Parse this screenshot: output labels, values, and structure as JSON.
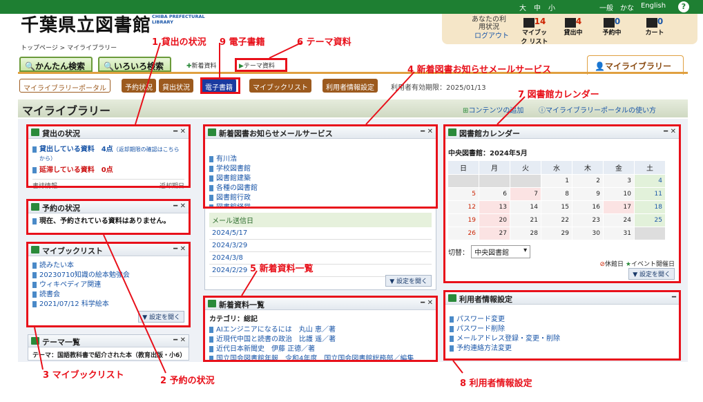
{
  "header": {
    "logo_text": "千葉県立図書館",
    "logo_sub": "CHIBA PREFECTURAL LIBRARY",
    "font_size_links": [
      "大",
      "中",
      "小"
    ],
    "lang_links": [
      "一般",
      "かな",
      "English"
    ],
    "help": "?",
    "status_label": "あなたの利用状況",
    "logout": "ログアウト",
    "stats": [
      {
        "label": "マイブック リスト",
        "count": "14",
        "icon": "bookshelf-icon"
      },
      {
        "label": "貸出中",
        "count": "4",
        "icon": "house-icon"
      },
      {
        "label": "予約中",
        "count": "0",
        "icon": "reserve-icon"
      },
      {
        "label": "カート",
        "count": "0",
        "icon": "cart-icon"
      }
    ]
  },
  "breadcrumb": "トップページ > マイライブラリー",
  "tabs": {
    "simple": "かんたん検索",
    "advanced": "いろいろ検索",
    "new": "新着資料",
    "theme": "テーマ資料",
    "mylibrary": "マイライブラリー"
  },
  "subnav": [
    "マイライブラリーポータル",
    "予約状況",
    "貸出状況",
    "電子書籍",
    "マイブックリスト",
    "利用者情報設定"
  ],
  "expiry": "利用者有効期限：2025/01/13",
  "page_title": "マイライブラリー",
  "title_links": [
    "コンテンツの追加",
    "マイライブラリーポータルの使い方"
  ],
  "loans": {
    "title": "貸出の状況",
    "line1": "貸出している資料　4点",
    "line1_note": "（返却期限の確認はこちらから）",
    "line2": "延滞している資料　0点",
    "col1": "書誌情報",
    "col2": "返却期日"
  },
  "reservations": {
    "title": "予約の状況",
    "text": "現在、予約されている資料はありません。"
  },
  "mybooklist": {
    "title": "マイブックリスト",
    "items": [
      "読みたい本",
      "20230710知識の絵本勉強会",
      "ウィキペディア関連",
      "読書会",
      "2021/07/12 科学絵本"
    ],
    "settings": "▼ 設定を開く"
  },
  "theme_list": {
    "title": "テーマ一覧",
    "text": "テーマ：国語教科書で紹介された本（教育出版・小6）"
  },
  "new_mail": {
    "title": "新着図書お知らせメールサービス",
    "items": [
      "有川浩",
      "学校図書館",
      "図書館建築",
      "各種の図書館",
      "図書館行政",
      "図書館経営"
    ],
    "date_header": "メール送信日",
    "dates": [
      "2024/5/17",
      "2024/3/29",
      "2024/3/8",
      "2024/2/29"
    ],
    "settings": "▼ 設定を開く"
  },
  "new_books": {
    "title": "新着資料一覧",
    "category": "カテゴリ：総記",
    "items": [
      "AIエンジニアになるには　丸山 恵／著",
      "近現代中国と読書の政治　比護 遥／著",
      "近代日本新聞史　伊藤 正德／著",
      "国立国会図書館年報　令和4年度　国立国会図書館総務部／編集"
    ]
  },
  "calendar": {
    "title": "図書館カレンダー",
    "heading": "中央図書館：2024年5月",
    "weekdays": [
      "日",
      "月",
      "火",
      "水",
      "木",
      "金",
      "土"
    ],
    "weeks": [
      [
        "",
        "",
        "",
        "1",
        "2",
        "3",
        "4"
      ],
      [
        "5",
        "6",
        "7",
        "8",
        "9",
        "10",
        "11"
      ],
      [
        "12",
        "13",
        "14",
        "15",
        "16",
        "17",
        "18"
      ],
      [
        "19",
        "20",
        "21",
        "22",
        "23",
        "24",
        "25"
      ],
      [
        "26",
        "27",
        "28",
        "29",
        "30",
        "31",
        ""
      ]
    ],
    "switch_label": "切替：",
    "switch_value": "中央図書館",
    "legend_closed": "休館日",
    "legend_event": "イベント開催日",
    "settings": "▼ 設定を開く"
  },
  "user_settings": {
    "title": "利用者情報設定",
    "items": [
      "パスワード変更",
      "パスワード削除",
      "メールアドレス登録・変更・削除",
      "予約連絡方法変更"
    ]
  },
  "annotations": [
    "1 貸出の状況",
    "9 電子書籍",
    "6 テーマ資料",
    "4 新着図書お知らせメールサービス",
    "7 図書館カレンダー",
    "5 新着資料一覧",
    "3 マイブックリスト",
    "2 予約の状況",
    "8 利用者情報設定"
  ],
  "colors": {
    "annotation": "#e8101a",
    "header_green": "#1e7f32",
    "accent_brown": "#9c5a1e"
  }
}
